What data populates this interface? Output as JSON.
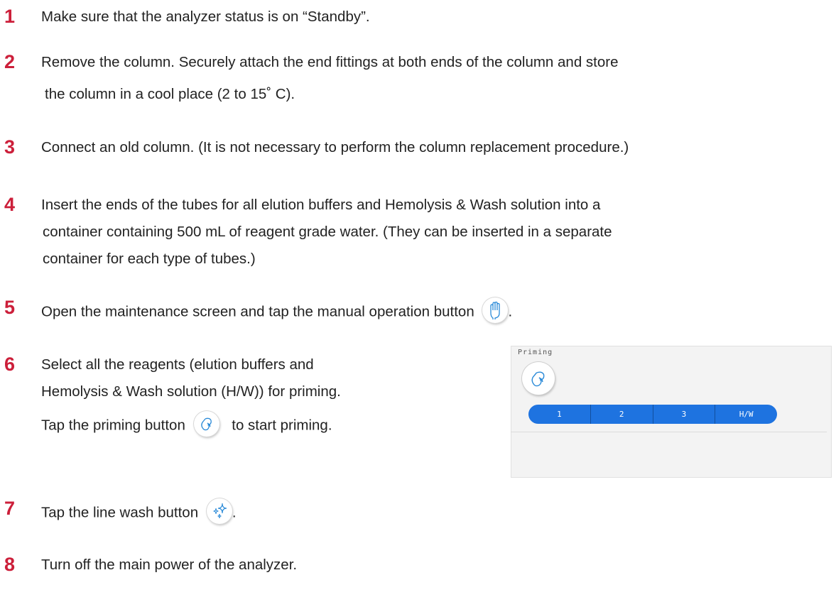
{
  "steps": [
    {
      "number": "1",
      "lines": [
        "Make sure that the analyzer status is on “Standby”."
      ]
    },
    {
      "number": "2",
      "lines": [
        "Remove the column. Securely attach the end fittings at both ends of the column and store",
        "the column in a cool place (2 to 15˚ C)."
      ]
    },
    {
      "number": "3",
      "lines": [
        "Connect an old column. (It is not necessary to perform the column replacement procedure.)"
      ]
    },
    {
      "number": "4",
      "lines": [
        "Insert the ends of the tubes for all elution buffers and Hemolysis & Wash solution into a",
        "container containing 500 mL of reagent grade water. (They can be inserted in a separate",
        "container for each type of tubes.)"
      ]
    },
    {
      "number": "5",
      "text": "Open the maintenance screen and tap the manual operation button",
      "icon": "hand-icon",
      "suffix": "."
    },
    {
      "number": "6",
      "lines": [
        "Select all the reagents (elution buffers and",
        "Hemolysis & Wash solution (H/W)) for priming."
      ],
      "line3_before": "Tap the priming button",
      "icon": "droplet-icon",
      "line3_after": "to start priming."
    },
    {
      "number": "7",
      "text": "Tap the line wash button",
      "icon": "sparkle-icon",
      "suffix": "."
    },
    {
      "number": "8",
      "lines": [
        "Turn off the main power of the analyzer."
      ]
    }
  ],
  "priming_panel": {
    "title": "Priming",
    "segments": [
      "1",
      "2",
      "3",
      "H/W"
    ],
    "accent": "#1e73e0"
  },
  "colors": {
    "step_number": "#cc1f3a",
    "text": "#222222"
  }
}
